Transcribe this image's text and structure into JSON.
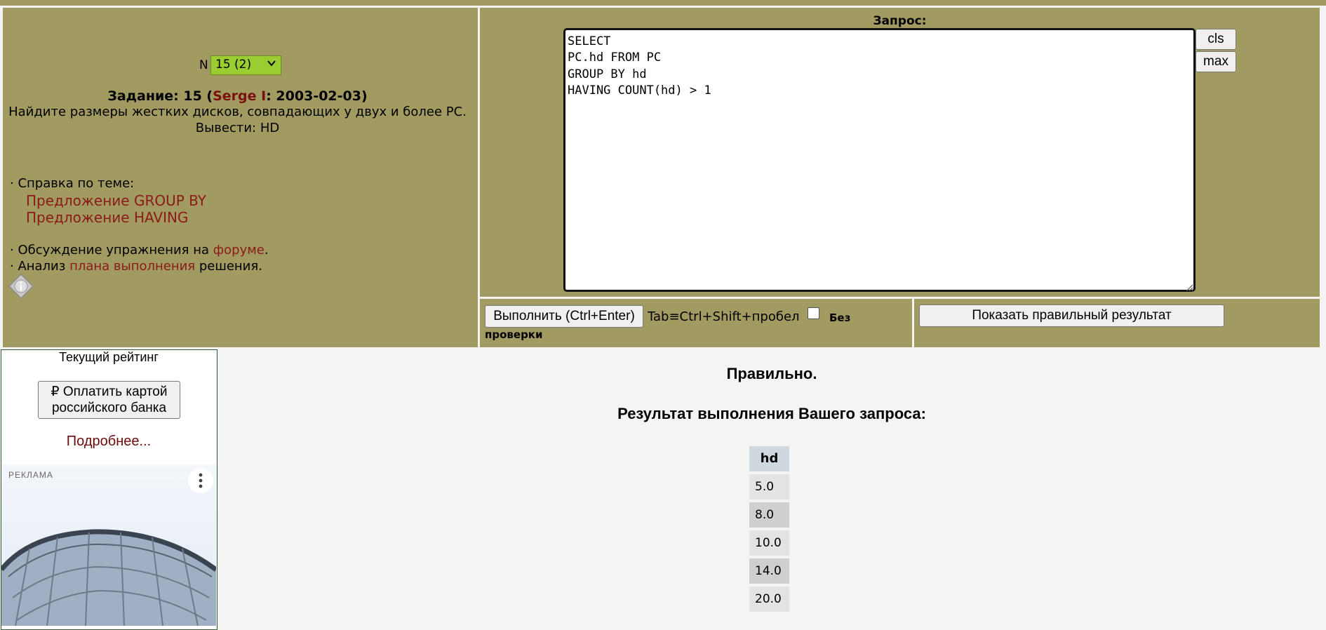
{
  "task": {
    "n_label": "N",
    "selected_task": "15 (2)",
    "title_prefix": "Задание: 15 (",
    "author": "Serge I",
    "title_suffix": ": 2003-02-03)",
    "description": "Найдите размеры жестких дисков, совпадающих у двух и более PC.",
    "output": "Вывести: HD"
  },
  "help": {
    "heading": "· Справка по теме:",
    "links": [
      "Предложение GROUP BY",
      "Предложение HAVING"
    ],
    "forum_prefix": "· Обсуждение упражнения на ",
    "forum_link": "форуме",
    "forum_suffix": ".",
    "plan_prefix": "· Анализ ",
    "plan_link": "плана выполнения",
    "plan_suffix": " решения."
  },
  "query": {
    "label": "Запрос:",
    "text": "SELECT\nPC.hd FROM PC\nGROUP BY hd\nHAVING COUNT(hd) > 1",
    "cls_label": "cls",
    "max_label": "max"
  },
  "execution": {
    "run_label": "Выполнить (Ctrl+Enter)",
    "tab_hint": "Tab≡Ctrl+Shift+пробел",
    "no_check_label_1": "Без",
    "no_check_label_2": "проверки",
    "no_check_checked": false,
    "show_result_label": "Показать правильный результат"
  },
  "rating": {
    "title": "Текущий рейтинг",
    "pay_line1": "₽ Оплатить картой",
    "pay_line2": "российского банка",
    "more_link": "Подробнее..."
  },
  "ad": {
    "label": "РЕКЛАМА"
  },
  "result": {
    "status": "Правильно.",
    "heading": "Результат выполнения Вашего запроса:",
    "columns": [
      "hd"
    ],
    "rows": [
      "5.0",
      "8.0",
      "10.0",
      "14.0",
      "20.0"
    ]
  },
  "colors": {
    "panel": "#a19a61",
    "select": "#9acd32",
    "link": "#8b1a1a"
  }
}
